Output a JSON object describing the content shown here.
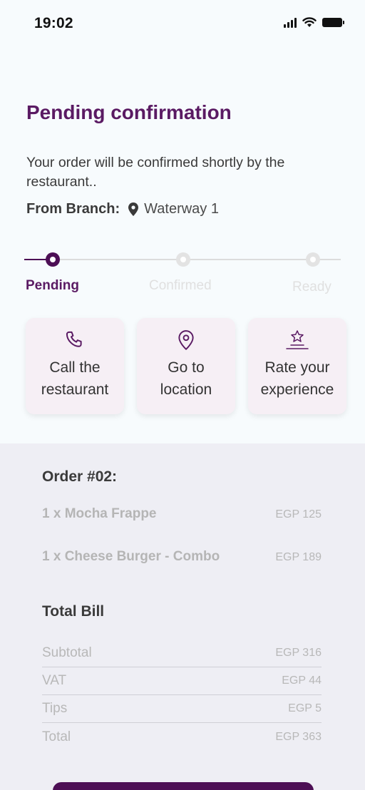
{
  "status_bar": {
    "time": "19:02"
  },
  "header": {
    "title": "Pending confirmation",
    "description": "Your order will be confirmed shortly by the restaurant..",
    "branch_label": "From Branch:",
    "branch_name": "Waterway 1"
  },
  "progress": {
    "steps": [
      {
        "label": "Pending",
        "state": "active"
      },
      {
        "label": "Confirmed",
        "state": "inactive"
      },
      {
        "label": "Ready",
        "state": "inactive"
      }
    ]
  },
  "actions": [
    {
      "label": "Call the\nrestaurant",
      "icon": "phone-icon"
    },
    {
      "label": "Go to\nlocation",
      "icon": "location-pin-icon"
    },
    {
      "label": "Rate your\nexperience",
      "icon": "star-icon"
    }
  ],
  "order": {
    "title": "Order #02:",
    "items": [
      {
        "name": "1 x Mocha Frappe",
        "price": "EGP 125"
      },
      {
        "name": "1 x Cheese Burger - Combo",
        "price": "EGP 189"
      }
    ]
  },
  "bill": {
    "title": "Total Bill",
    "rows": [
      {
        "label": "Subtotal",
        "value": "EGP 316"
      },
      {
        "label": "VAT",
        "value": "EGP 44"
      },
      {
        "label": "Tips",
        "value": "EGP 5"
      },
      {
        "label": "Total",
        "value": "EGP 363"
      }
    ]
  },
  "colors": {
    "primary": "#4d0f55",
    "title": "#5a1a63",
    "card_bg": "#f6eff5",
    "panel_bg": "#eeeef4"
  }
}
